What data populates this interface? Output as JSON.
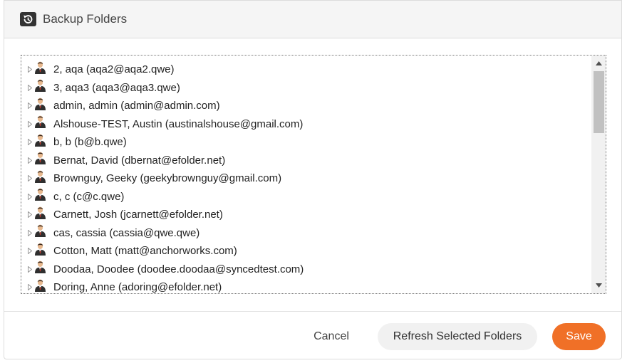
{
  "header": {
    "title": "Backup Folders",
    "icon": "backup-restore-icon"
  },
  "tree": {
    "items": [
      {
        "label": "2, aqa (aqa2@aqa2.qwe)"
      },
      {
        "label": "3, aqa3 (aqa3@aqa3.qwe)"
      },
      {
        "label": "admin, admin (admin@admin.com)"
      },
      {
        "label": "Alshouse-TEST, Austin (austinalshouse@gmail.com)"
      },
      {
        "label": "b, b (b@b.qwe)"
      },
      {
        "label": "Bernat, David (dbernat@efolder.net)"
      },
      {
        "label": "Brownguy, Geeky (geekybrownguy@gmail.com)"
      },
      {
        "label": "c, c (c@c.qwe)"
      },
      {
        "label": "Carnett, Josh (jcarnett@efolder.net)"
      },
      {
        "label": "cas, cassia (cassia@qwe.qwe)"
      },
      {
        "label": "Cotton, Matt (matt@anchorworks.com)"
      },
      {
        "label": "Doodaa, Doodee (doodee.doodaa@syncedtest.com)"
      },
      {
        "label": "Doring, Anne (adoring@efolder.net)"
      }
    ]
  },
  "footer": {
    "cancel_label": "Cancel",
    "refresh_label": "Refresh Selected Folders",
    "save_label": "Save"
  },
  "colors": {
    "accent": "#f07027",
    "header_bg": "#f5f5f5"
  }
}
